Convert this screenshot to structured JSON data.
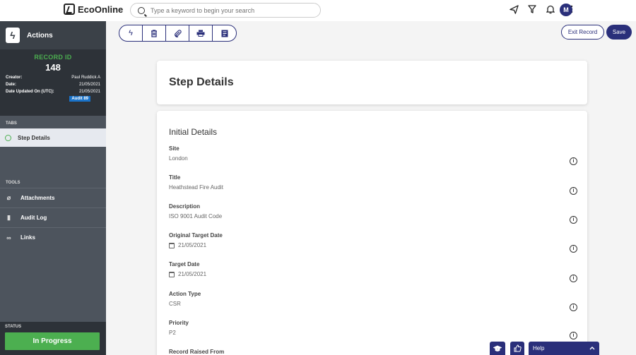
{
  "header": {
    "logo_text": "EcoOnline",
    "search_placeholder": "Type a keyword to begin your search",
    "icons": [
      "send-icon",
      "filter-icon",
      "bell-icon",
      "apps-grid-icon"
    ],
    "avatar_initial": "M"
  },
  "sidebar": {
    "title": "Actions",
    "record_label": "RECORD ID",
    "record_id": "148",
    "meta": [
      {
        "key": "Creator:",
        "value": "Paul Ruddick A"
      },
      {
        "key": "Date:",
        "value": "21/05/2021"
      },
      {
        "key": "Date Updated On (UTC):",
        "value": "21/05/2021"
      }
    ],
    "badge": "Audit 89",
    "tabs_label": "TABS",
    "tabs": [
      {
        "label": "Step Details"
      }
    ],
    "tools_label": "TOOLS",
    "tools": [
      {
        "label": "Attachments",
        "icon": "paperclip-icon"
      },
      {
        "label": "Audit Log",
        "icon": "book-icon"
      },
      {
        "label": "Links",
        "icon": "link-icon"
      }
    ],
    "status_label": "STATUS",
    "status_value": "In Progress",
    "status_color": "#4caf50"
  },
  "toolbar": {
    "buttons": [
      "lightning-icon",
      "trash-icon",
      "paperclip-icon",
      "printer-icon",
      "document-icon"
    ],
    "exit_label": "Exit Record",
    "save_label": "Save"
  },
  "main": {
    "page_title": "Step Details",
    "section_title": "Initial Details",
    "fields": [
      {
        "label": "Site",
        "value": "London"
      },
      {
        "label": "Title",
        "value": "Heathstead Fire Audit"
      },
      {
        "label": "Description",
        "value": "ISO 9001 Audit Code"
      },
      {
        "label": "Original Target Date",
        "value": "21/05/2021",
        "calendar": true
      },
      {
        "label": "Target Date",
        "value": "21/05/2021",
        "calendar": true
      },
      {
        "label": "Action Type",
        "value": "CSR"
      },
      {
        "label": "Priority",
        "value": "P2"
      },
      {
        "label": "Record Raised From",
        "value": ""
      }
    ]
  },
  "widgets": {
    "help_label": "Help"
  },
  "colors": {
    "accent": "#2a2f7a",
    "sidebar": "#4d545d",
    "success": "#4caf50"
  }
}
